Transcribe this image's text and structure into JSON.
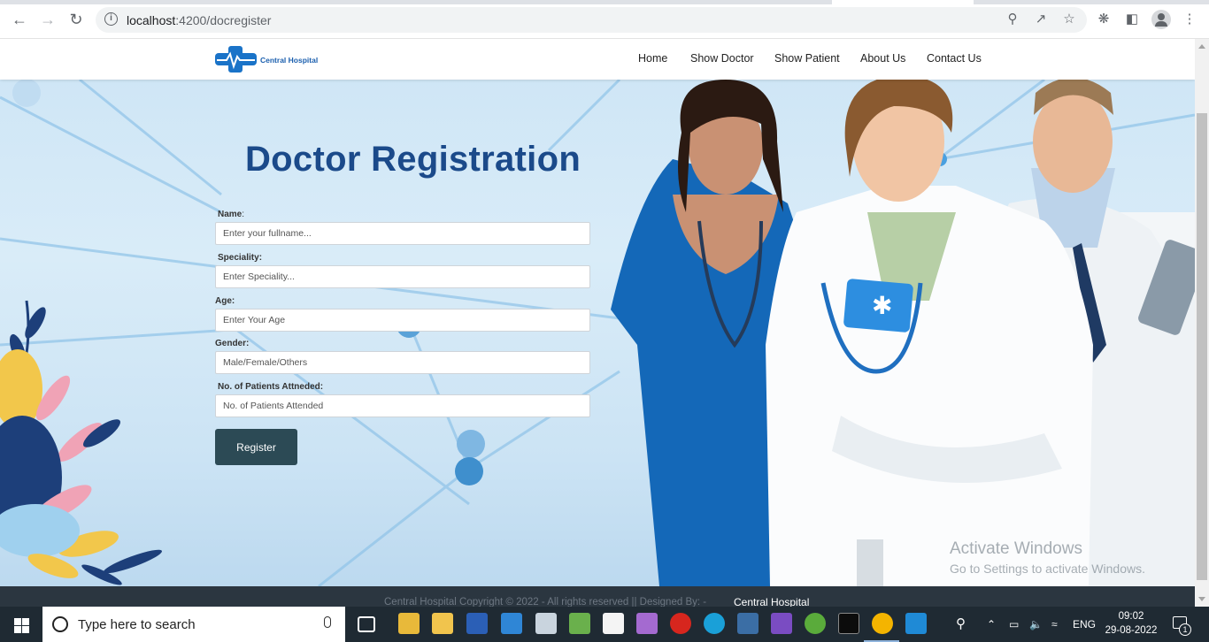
{
  "browser": {
    "url_host": "localhost",
    "url_path": ":4200/docregister"
  },
  "header": {
    "logo_text": "Central Hospital",
    "nav": [
      {
        "label": "Home"
      },
      {
        "label": "Show Doctor"
      },
      {
        "label": "Show Patient"
      },
      {
        "label": "About Us"
      },
      {
        "label": "Contact Us"
      }
    ]
  },
  "form": {
    "title": "Doctor Registration",
    "fields": [
      {
        "label": "Name",
        "suffix": ":",
        "placeholder": "Enter your fullname...",
        "value": ""
      },
      {
        "label": "Speciality:",
        "suffix": "",
        "placeholder": "Enter Speciality...",
        "value": ""
      },
      {
        "label": "Age:",
        "suffix": "",
        "placeholder": "Enter Your Age",
        "value": ""
      },
      {
        "label": "Gender:",
        "suffix": "",
        "placeholder": "Male/Female/Others",
        "value": ""
      },
      {
        "label": "No. of Patients Attneded:",
        "suffix": "",
        "placeholder": "No. of Patients Attended",
        "value": ""
      }
    ],
    "submit_label": "Register"
  },
  "watermark": {
    "title": "Activate Windows",
    "subtitle": "Go to Settings to activate Windows."
  },
  "footer": {
    "text": "Central Hospital Copyright © 2022 - All rights reserved || Designed By:  -",
    "brand": "Central Hospital"
  },
  "taskbar": {
    "search_placeholder": "Type here to search",
    "language": "ENG",
    "time": "09:02",
    "date": "29-08-2022",
    "notification_count": "1"
  },
  "colors": {
    "title": "#1b4a8a",
    "button": "#2c4a55",
    "footer": "#2b3640",
    "taskbar": "#1f2a33"
  }
}
